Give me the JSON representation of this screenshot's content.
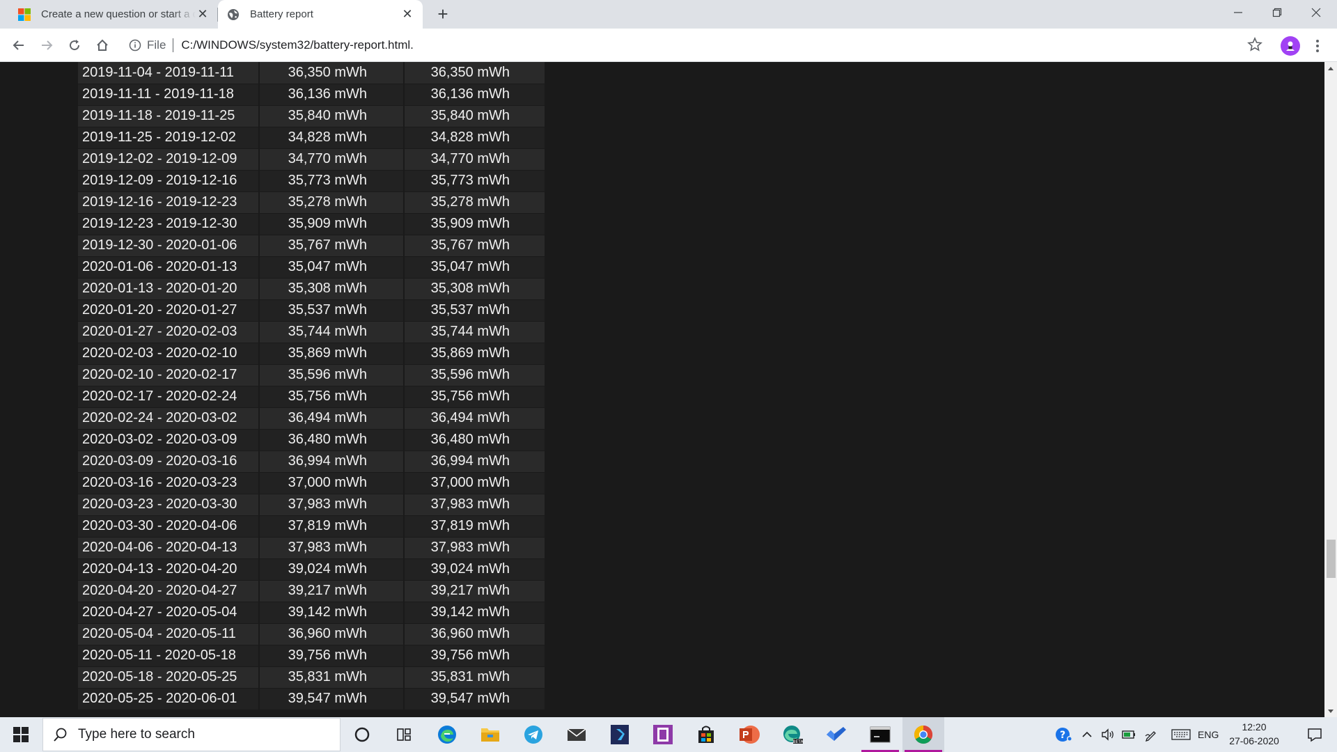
{
  "browser": {
    "tabs": [
      {
        "title": "Create a new question or start a discussion",
        "active": false,
        "favicon": "microsoft-logo-icon"
      },
      {
        "title": "Battery report",
        "active": true,
        "favicon": "globe-icon"
      }
    ],
    "address": {
      "scheme": "File",
      "url": "C:/WINDOWS/system32/battery-report.html."
    },
    "profile_color": "#a142f4"
  },
  "capacity_history": [
    {
      "period": "2019-11-04 - 2019-11-11",
      "full_charge": "36,350 mWh",
      "design": "36,350 mWh"
    },
    {
      "period": "2019-11-11 - 2019-11-18",
      "full_charge": "36,136 mWh",
      "design": "36,136 mWh"
    },
    {
      "period": "2019-11-18 - 2019-11-25",
      "full_charge": "35,840 mWh",
      "design": "35,840 mWh"
    },
    {
      "period": "2019-11-25 - 2019-12-02",
      "full_charge": "34,828 mWh",
      "design": "34,828 mWh"
    },
    {
      "period": "2019-12-02 - 2019-12-09",
      "full_charge": "34,770 mWh",
      "design": "34,770 mWh"
    },
    {
      "period": "2019-12-09 - 2019-12-16",
      "full_charge": "35,773 mWh",
      "design": "35,773 mWh"
    },
    {
      "period": "2019-12-16 - 2019-12-23",
      "full_charge": "35,278 mWh",
      "design": "35,278 mWh"
    },
    {
      "period": "2019-12-23 - 2019-12-30",
      "full_charge": "35,909 mWh",
      "design": "35,909 mWh"
    },
    {
      "period": "2019-12-30 - 2020-01-06",
      "full_charge": "35,767 mWh",
      "design": "35,767 mWh"
    },
    {
      "period": "2020-01-06 - 2020-01-13",
      "full_charge": "35,047 mWh",
      "design": "35,047 mWh"
    },
    {
      "period": "2020-01-13 - 2020-01-20",
      "full_charge": "35,308 mWh",
      "design": "35,308 mWh"
    },
    {
      "period": "2020-01-20 - 2020-01-27",
      "full_charge": "35,537 mWh",
      "design": "35,537 mWh"
    },
    {
      "period": "2020-01-27 - 2020-02-03",
      "full_charge": "35,744 mWh",
      "design": "35,744 mWh"
    },
    {
      "period": "2020-02-03 - 2020-02-10",
      "full_charge": "35,869 mWh",
      "design": "35,869 mWh"
    },
    {
      "period": "2020-02-10 - 2020-02-17",
      "full_charge": "35,596 mWh",
      "design": "35,596 mWh"
    },
    {
      "period": "2020-02-17 - 2020-02-24",
      "full_charge": "35,756 mWh",
      "design": "35,756 mWh"
    },
    {
      "period": "2020-02-24 - 2020-03-02",
      "full_charge": "36,494 mWh",
      "design": "36,494 mWh"
    },
    {
      "period": "2020-03-02 - 2020-03-09",
      "full_charge": "36,480 mWh",
      "design": "36,480 mWh"
    },
    {
      "period": "2020-03-09 - 2020-03-16",
      "full_charge": "36,994 mWh",
      "design": "36,994 mWh"
    },
    {
      "period": "2020-03-16 - 2020-03-23",
      "full_charge": "37,000 mWh",
      "design": "37,000 mWh"
    },
    {
      "period": "2020-03-23 - 2020-03-30",
      "full_charge": "37,983 mWh",
      "design": "37,983 mWh"
    },
    {
      "period": "2020-03-30 - 2020-04-06",
      "full_charge": "37,819 mWh",
      "design": "37,819 mWh"
    },
    {
      "period": "2020-04-06 - 2020-04-13",
      "full_charge": "37,983 mWh",
      "design": "37,983 mWh"
    },
    {
      "period": "2020-04-13 - 2020-04-20",
      "full_charge": "39,024 mWh",
      "design": "39,024 mWh"
    },
    {
      "period": "2020-04-20 - 2020-04-27",
      "full_charge": "39,217 mWh",
      "design": "39,217 mWh"
    },
    {
      "period": "2020-04-27 - 2020-05-04",
      "full_charge": "39,142 mWh",
      "design": "39,142 mWh"
    },
    {
      "period": "2020-05-04 - 2020-05-11",
      "full_charge": "36,960 mWh",
      "design": "36,960 mWh"
    },
    {
      "period": "2020-05-11 - 2020-05-18",
      "full_charge": "39,756 mWh",
      "design": "39,756 mWh"
    },
    {
      "period": "2020-05-18 - 2020-05-25",
      "full_charge": "35,831 mWh",
      "design": "35,831 mWh"
    },
    {
      "period": "2020-05-25 - 2020-06-01",
      "full_charge": "39,547 mWh",
      "design": "39,547 mWh"
    }
  ],
  "taskbar": {
    "search_placeholder": "Type here to search",
    "pinned": [
      "cortana-icon",
      "task-view-icon",
      "edge-icon",
      "file-explorer-icon",
      "telegram-icon",
      "mail-icon",
      "visual-studio-icon",
      "onenote-icon",
      "store-icon",
      "powerpoint-icon",
      "edge-beta-icon",
      "todo-icon",
      "command-prompt-icon",
      "chrome-icon"
    ],
    "language": "ENG",
    "time": "12:20",
    "date": "27-06-2020"
  }
}
